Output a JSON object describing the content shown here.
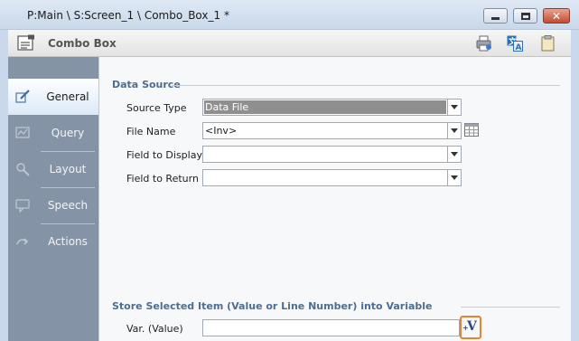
{
  "window": {
    "title": "P:Main \\ S:Screen_1 \\ Combo_Box_1 *",
    "close_glyph": "✕"
  },
  "header": {
    "title": "Combo Box",
    "icons": [
      "combo-box-icon",
      "print-icon",
      "translate-icon",
      "clipboard-icon"
    ]
  },
  "sidebar": {
    "items": [
      {
        "label": "General",
        "icon": "pencil-icon",
        "active": true
      },
      {
        "label": "Query",
        "icon": "query-icon",
        "active": false
      },
      {
        "label": "Layout",
        "icon": "layout-icon",
        "active": false
      },
      {
        "label": "Speech",
        "icon": "speech-icon",
        "active": false
      },
      {
        "label": "Actions",
        "icon": "actions-icon",
        "active": false
      }
    ]
  },
  "data_source": {
    "title": "Data Source",
    "fields": [
      {
        "label": "Source Type",
        "value": "Data File"
      },
      {
        "label": "File Name",
        "value": "<Inv>"
      },
      {
        "label": "Field to Display",
        "value": ""
      },
      {
        "label": "Field to Return",
        "value": ""
      }
    ]
  },
  "store": {
    "title": "Store Selected Item (Value or Line Number) into Variable",
    "var_label": "Var. (Value)",
    "var_value": "",
    "var_button_glyph": "V",
    "var_button_plus": "+"
  },
  "colors": {
    "accent_orange": "#e8822e",
    "section_title": "#4d6e8f",
    "sidebar_bg": "#8593a6"
  }
}
